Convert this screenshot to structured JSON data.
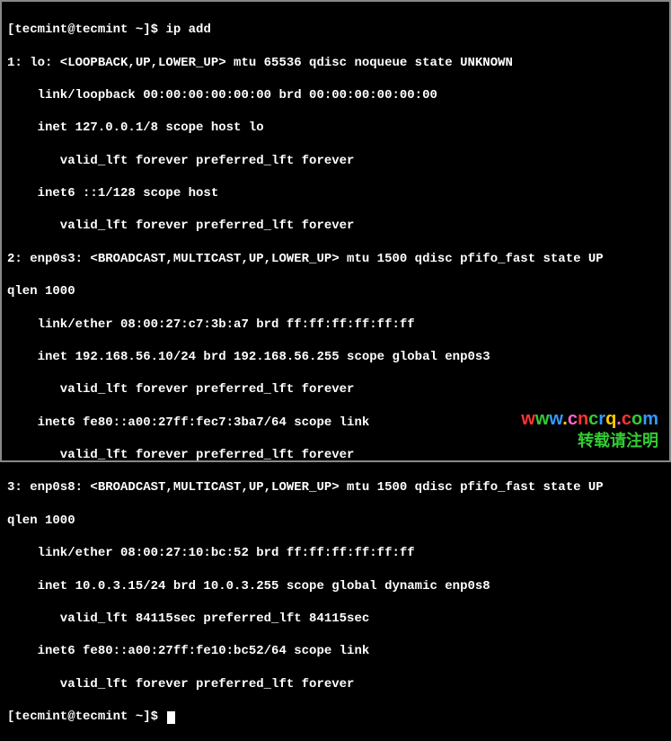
{
  "prompt1": "[tecmint@tecmint ~]$ ",
  "command": "ip add",
  "output": [
    "1: lo: <LOOPBACK,UP,LOWER_UP> mtu 65536 qdisc noqueue state UNKNOWN",
    "    link/loopback 00:00:00:00:00:00 brd 00:00:00:00:00:00",
    "    inet 127.0.0.1/8 scope host lo",
    "       valid_lft forever preferred_lft forever",
    "    inet6 ::1/128 scope host",
    "       valid_lft forever preferred_lft forever",
    "2: enp0s3: <BROADCAST,MULTICAST,UP,LOWER_UP> mtu 1500 qdisc pfifo_fast state UP",
    "qlen 1000",
    "    link/ether 08:00:27:c7:3b:a7 brd ff:ff:ff:ff:ff:ff",
    "    inet 192.168.56.10/24 brd 192.168.56.255 scope global enp0s3",
    "       valid_lft forever preferred_lft forever",
    "    inet6 fe80::a00:27ff:fec7:3ba7/64 scope link",
    "       valid_lft forever preferred_lft forever",
    "3: enp0s8: <BROADCAST,MULTICAST,UP,LOWER_UP> mtu 1500 qdisc pfifo_fast state UP",
    "qlen 1000",
    "    link/ether 08:00:27:10:bc:52 brd ff:ff:ff:ff:ff:ff",
    "    inet 10.0.3.15/24 brd 10.0.3.255 scope global dynamic enp0s8",
    "       valid_lft 84115sec preferred_lft 84115sec",
    "    inet6 fe80::a00:27ff:fe10:bc52/64 scope link",
    "       valid_lft forever preferred_lft forever"
  ],
  "prompt2": "[tecmint@tecmint ~]$ ",
  "watermark": {
    "url_chars": [
      "w",
      "w",
      "w",
      ".",
      "c",
      "n",
      "c",
      "r",
      "q",
      ".",
      "c",
      "o",
      "m"
    ],
    "line2": "转载请注明"
  }
}
